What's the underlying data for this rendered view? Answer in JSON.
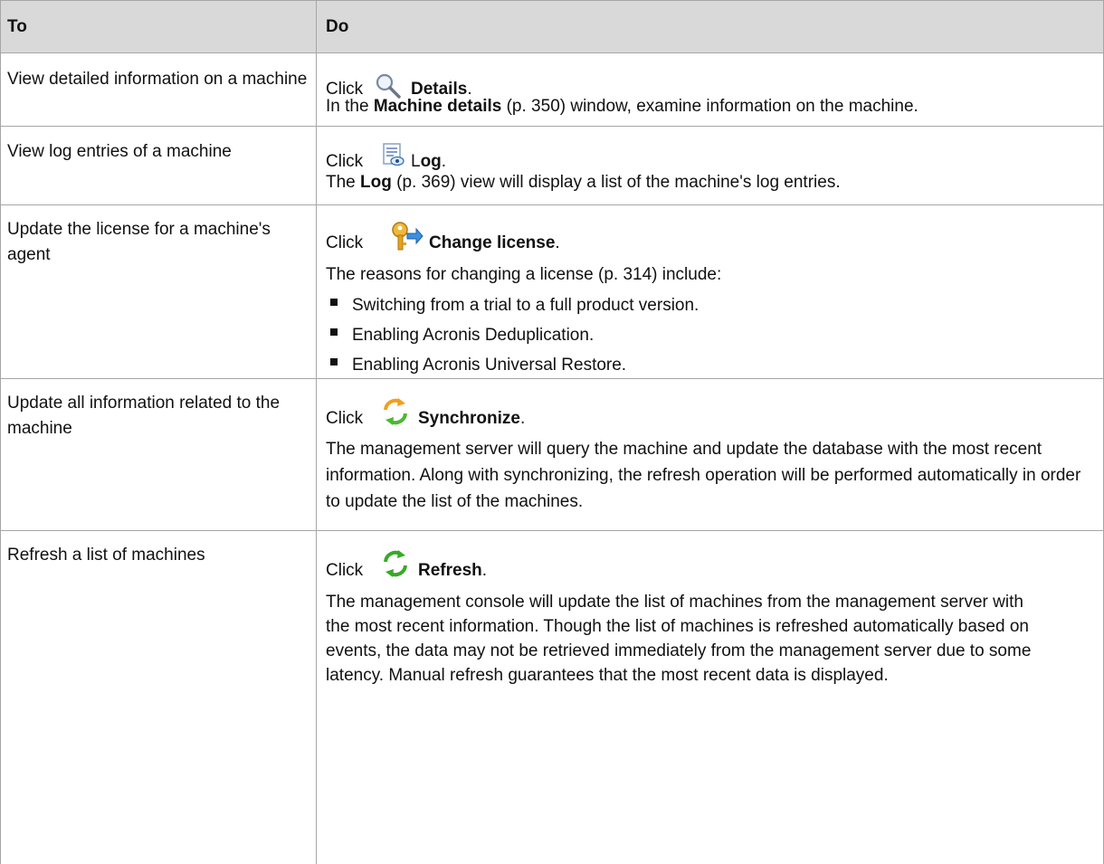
{
  "header": {
    "col_to": "To",
    "col_do": "Do"
  },
  "rows": [
    {
      "to": "View detailed information on a machine",
      "click_prefix": "Click",
      "action_label": "Details",
      "action_icon": "magnifier-icon",
      "desc_bold": "Machine details",
      "desc_rest": " (p. 350) window, examine information on the machine.",
      "desc_prefix": "In the "
    },
    {
      "to": "View log entries of a machine",
      "click_prefix": "Click",
      "action_label_plain": "L",
      "action_label": "og",
      "action_icon": "log-icon",
      "desc_prefix": "The ",
      "desc_bold": "Log",
      "desc_rest": " (p. 369) view will display a list of the machine's log entries."
    },
    {
      "to": "Update the license for a machine's agent",
      "click_prefix": "Click",
      "action_label": "Change license",
      "action_icon": "key-icon",
      "desc": "The reasons for changing a license (p. 314) include:",
      "bullets": [
        "Switching from a trial to a full product version.",
        "Enabling Acronis Deduplication.",
        "Enabling Acronis Universal Restore."
      ]
    },
    {
      "to": "Update all information related to the machine",
      "click_prefix": "Click",
      "action_label": "Synchronize",
      "action_icon": "synchronize-icon",
      "desc": "The management server will query the machine and update the database with the most recent information. Along with synchronizing, the refresh operation will be performed automatically in order to update the list of the machines."
    },
    {
      "to": "Refresh a list of machines",
      "click_prefix": "Click",
      "action_label": "Refresh",
      "action_icon": "refresh-icon",
      "desc": "The management console will update the list of machines from the management server with the most recent information. Though the list of machines is refreshed automatically based on events, the data may not be retrieved immediately from the management server due to some latency. Manual refresh guarantees that the most recent data is displayed."
    }
  ],
  "colors": {
    "header_bg": "#d9d9d9",
    "border": "#a6a6a6"
  }
}
